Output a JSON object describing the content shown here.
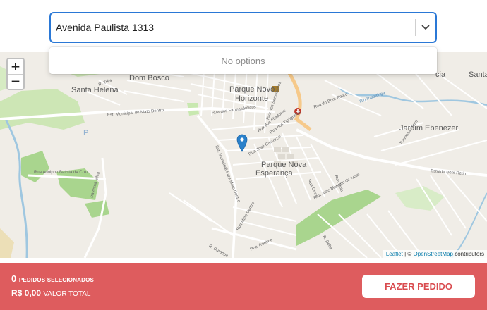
{
  "search": {
    "value": "Avenida Paulista 1313",
    "no_options": "No options"
  },
  "map": {
    "zoom_in": "+",
    "zoom_out": "−",
    "attribution": {
      "leaflet": "Leaflet",
      "separator": " | © ",
      "osm": "OpenStreetMap",
      "suffix": " contributors"
    },
    "neighborhoods": {
      "santa_helena": "Santa Helena",
      "dom_bosco": "Dom Bosco",
      "parque_novo_horizonte_1": "Parque Novo",
      "parque_novo_horizonte_2": "Horizonte",
      "parque_nova_esperanca_1": "Parque Nova",
      "parque_nova_esperanca_2": "Esperança",
      "jardim_ebenezer": "Jardim Ebenezer",
      "santa": "Santa",
      "cia": "cia"
    },
    "streets": {
      "municipal_mato_dentro": "Est. Municipal do Mato Dentro",
      "estrada_bom_retiro": "Estrada Bom Retiro",
      "adolpho_batista": "Rua Adolpho Batista da Cruz",
      "travessa_silva": "Travessa Silva",
      "est_municipal_para_mato": "Est. Municipal Para Mato Dentro",
      "farmaceuticos": "Rua dos Farmacêuticos",
      "tipografos": "Rua dos Tipógrafos",
      "afiadores": "Rua dos Afiadores",
      "jose_castrezzi": "Rua José Castrezzi",
      "serralheiros": "Rua dos Serralheiros",
      "bom_retiro": "Rua do Bom Retiro",
      "jao_mariano": "Rua João Mariano de Assis",
      "rua_dois": "Rua Dois",
      "rio_paraitinga": "Rio Paraitinga",
      "r_durango": "R. Durango",
      "rua_trentino": "Rua Trentino",
      "rua_mato_dentro": "Rua Mato Dentro",
      "rua_tres": "R. Três",
      "rua_cinco": "Rua Cinco",
      "rua_delta": "R. Delta",
      "travessa_mirim": "Travessa Mirim"
    }
  },
  "footer": {
    "count": "0",
    "count_label": "PEDIDOS SELECIONADOS",
    "total": "R$ 0,00",
    "total_label": "VALOR TOTAL",
    "button_label": "FAZER PEDIDO",
    "bar_color": "#de5c5e",
    "button_text_color": "#d94b4f"
  }
}
